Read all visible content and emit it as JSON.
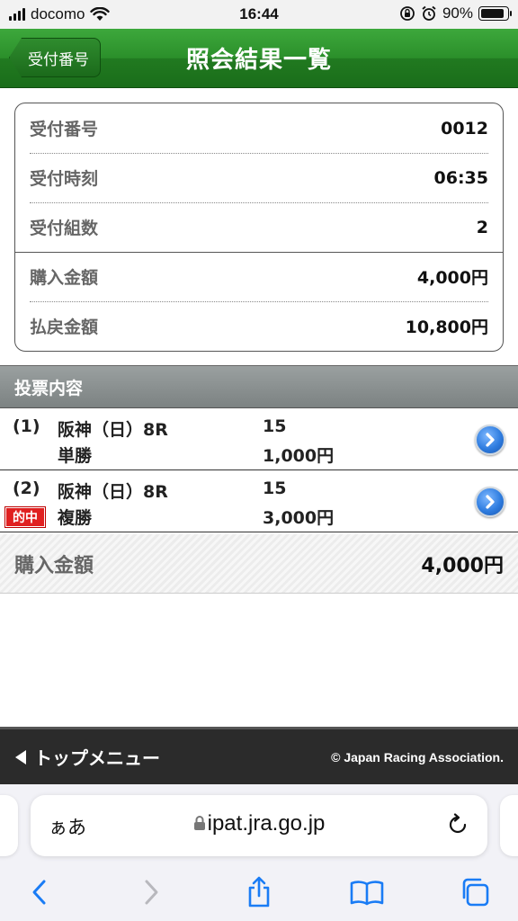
{
  "status_bar": {
    "carrier": "docomo",
    "time": "16:44",
    "battery": "90%",
    "battery_level": 0.9
  },
  "header": {
    "back_label": "受付番号",
    "title": "照会結果一覧"
  },
  "summary": {
    "rows": [
      {
        "label": "受付番号",
        "value": "0012"
      },
      {
        "label": "受付時刻",
        "value": "06:35"
      },
      {
        "label": "受付組数",
        "value": "2"
      },
      {
        "label": "購入金額",
        "value": "4,000円"
      },
      {
        "label": "払戻金額",
        "value": "10,800円"
      }
    ]
  },
  "section": {
    "title": "投票内容"
  },
  "bets": [
    {
      "number": "(1)",
      "race": "阪神（日）8R",
      "type": "単勝",
      "horse": "15",
      "amount": "1,000円",
      "hit": ""
    },
    {
      "number": "(2)",
      "race": "阪神（日）8R",
      "type": "複勝",
      "horse": "15",
      "amount": "3,000円",
      "hit": "的中"
    }
  ],
  "total": {
    "label": "購入金額",
    "value": "4,000円"
  },
  "footer": {
    "top_menu": "トップメニュー",
    "copyright": "© Japan Racing Association."
  },
  "safari": {
    "aa": "ぁあ",
    "url": "ipat.jra.go.jp"
  },
  "colors": {
    "header_green": "#2b8f2a",
    "section_gray": "#8a9090",
    "hit_red": "#e02020",
    "footer_dark": "#2b2b2b",
    "ios_blue": "#1a7cf5"
  }
}
